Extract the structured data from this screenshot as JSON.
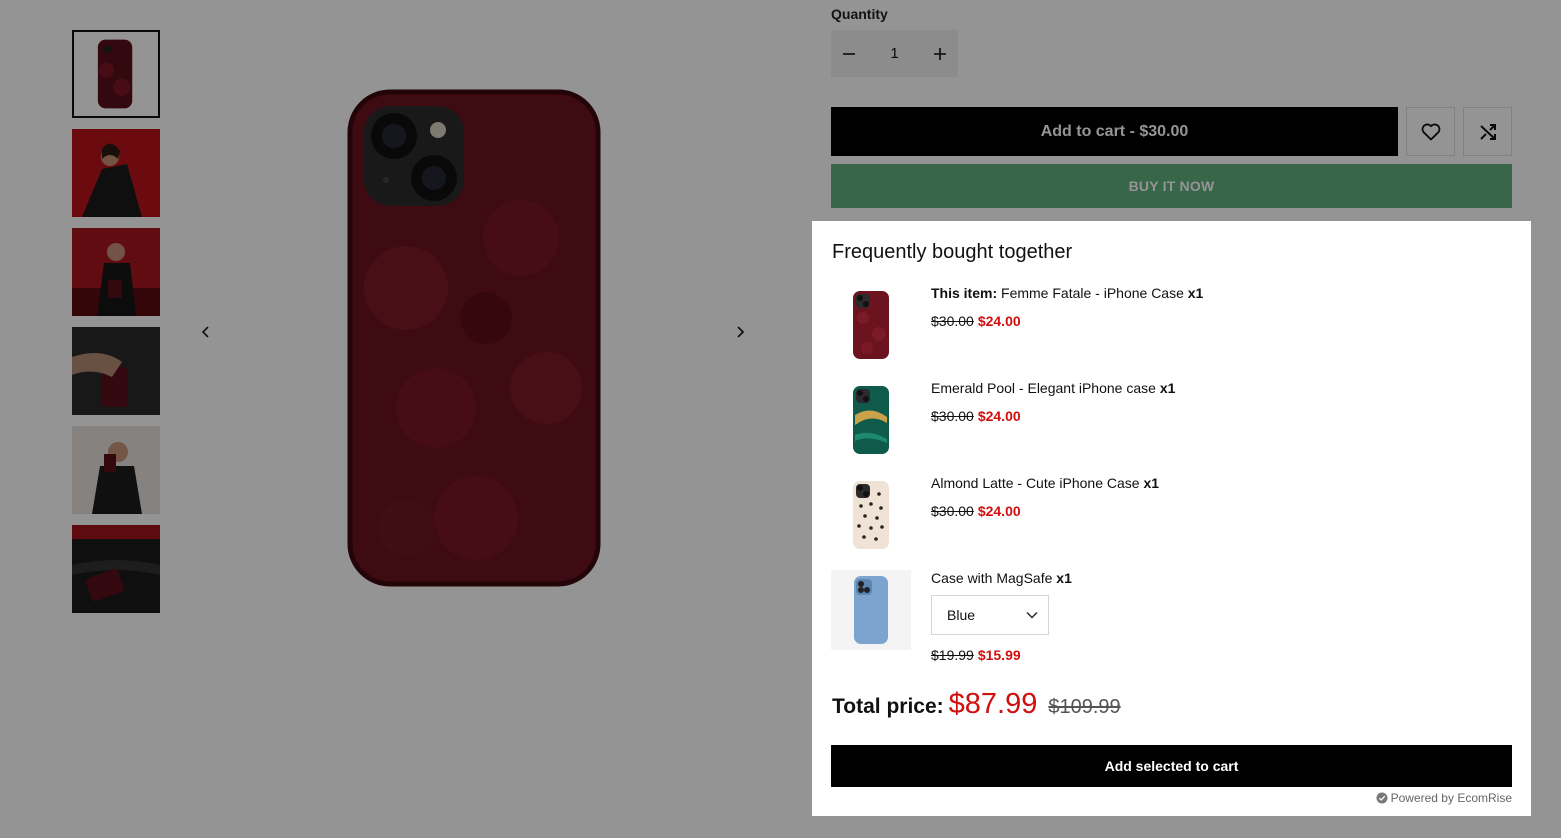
{
  "product_form": {
    "quantity_label": "Quantity",
    "quantity_value": "1",
    "add_to_cart_label": "Add to cart - $30.00",
    "buy_now_label": "BUY IT NOW"
  },
  "gallery": {
    "thumbnail_count": 6,
    "active_index": 0
  },
  "fbt": {
    "title": "Frequently bought together",
    "items": [
      {
        "prefix": "This item:",
        "name": "Femme Fatale - iPhone Case",
        "qty": "x1",
        "old_price": "$30.00",
        "new_price": "$24.00",
        "image_icon": "burgundy-rose-case"
      },
      {
        "prefix": "",
        "name": "Emerald Pool - Elegant iPhone case",
        "qty": "x1",
        "old_price": "$30.00",
        "new_price": "$24.00",
        "image_icon": "emerald-marble-case"
      },
      {
        "prefix": "",
        "name": "Almond Latte - Cute iPhone Case",
        "qty": "x1",
        "old_price": "$30.00",
        "new_price": "$24.00",
        "image_icon": "leopard-print-case"
      },
      {
        "prefix": "",
        "name": "Case with MagSafe",
        "qty": "x1",
        "variant": "Blue",
        "old_price": "$19.99",
        "new_price": "$15.99",
        "image_icon": "blue-magsafe-case"
      }
    ],
    "total_label": "Total price:",
    "total_new": "$87.99",
    "total_old": "$109.99",
    "add_selected_label": "Add selected to cart",
    "powered_by": "Powered by EcomRise"
  },
  "colors": {
    "accent_red": "#d10f0f",
    "buy_now_green": "#5fb07f",
    "case_burgundy": "#6b1420"
  }
}
